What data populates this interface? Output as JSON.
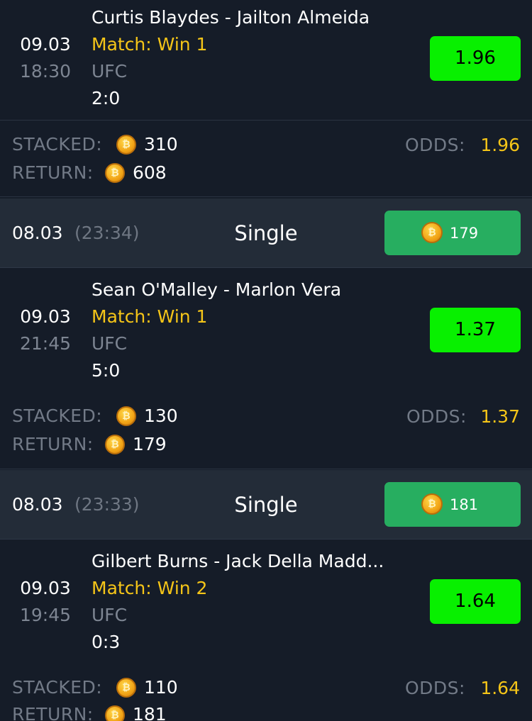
{
  "bets": [
    {
      "date": "09.03",
      "time": "18:30",
      "teams": "Curtis Blaydes - Jailton Almeida",
      "market": "Match: Win 1",
      "league": "UFC",
      "score": "2:0",
      "odds": "1.96",
      "stacked_label": "STACKED:",
      "stacked": "310",
      "return_label": "RETURN:",
      "return": "608",
      "odds_label": "ODDS:",
      "odds_value": "1.96"
    },
    {
      "date": "09.03",
      "time": "21:45",
      "teams": "Sean O'Malley - Marlon Vera",
      "market": "Match: Win 1",
      "league": "UFC",
      "score": "5:0",
      "odds": "1.37",
      "stacked_label": "STACKED:",
      "stacked": "130",
      "return_label": "RETURN:",
      "return": "179",
      "odds_label": "ODDS:",
      "odds_value": "1.37"
    },
    {
      "date": "09.03",
      "time": "19:45",
      "teams": "Gilbert Burns - Jack Della Madd...",
      "market": "Match: Win 2",
      "league": "UFC",
      "score": "0:3",
      "odds": "1.64",
      "stacked_label": "STACKED:",
      "stacked": "110",
      "return_label": "RETURN:",
      "return": "181",
      "odds_label": "ODDS:",
      "odds_value": "1.64"
    }
  ],
  "tickets": [
    {
      "date": "08.03",
      "time": "(23:34)",
      "type": "Single",
      "win": "179"
    },
    {
      "date": "08.03",
      "time": "(23:33)",
      "type": "Single",
      "win": "181"
    }
  ],
  "icons": {
    "coin": "coin-icon",
    "coin_glyph": "₿"
  },
  "colors": {
    "background": "#151c28",
    "header_background": "#232c38",
    "odds_button": "#08f000",
    "win_button": "#27ae60",
    "accent_yellow": "#f5c518",
    "muted": "#727a87"
  }
}
